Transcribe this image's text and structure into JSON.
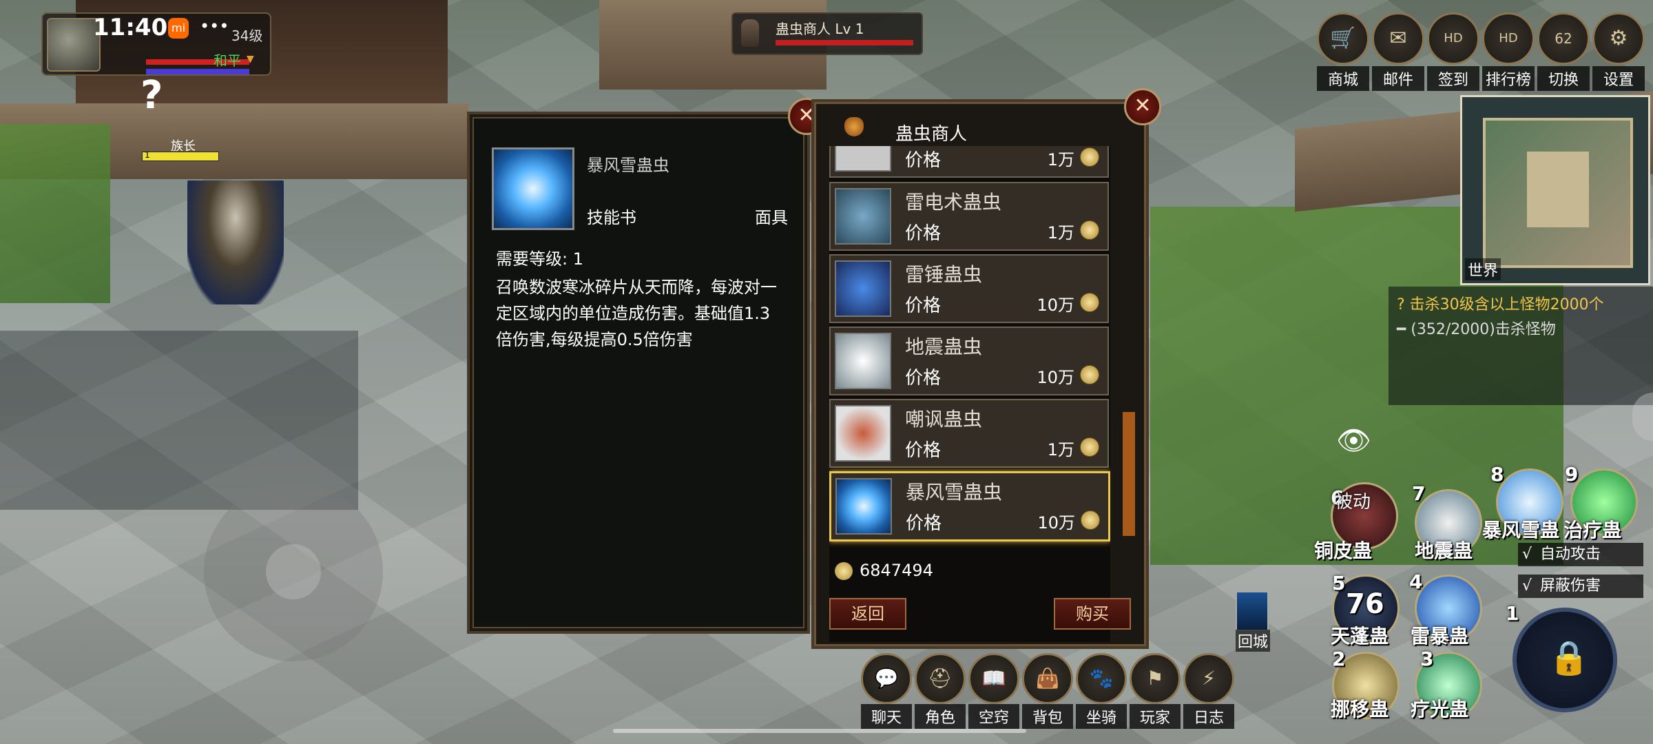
{
  "status": {
    "time": "11:40",
    "app_badge": "mi",
    "menu_dots": "•••",
    "battery": "62"
  },
  "player": {
    "level": "34级",
    "mode": "和平",
    "mode_arrow": "▼"
  },
  "target": {
    "name": "蛊虫商人  Lv 1"
  },
  "npc": {
    "marker": "?",
    "title": "族长",
    "hp_level": "1"
  },
  "top_menu": [
    {
      "label": "商城",
      "icon": "cart-icon",
      "glyph": "🛒"
    },
    {
      "label": "邮件",
      "icon": "mail-icon",
      "glyph": "✉"
    },
    {
      "label": "签到",
      "icon": "signal-icon",
      "glyph": "HD"
    },
    {
      "label": "排行榜",
      "icon": "rank-icon",
      "glyph": "HD"
    },
    {
      "label": "切换",
      "icon": "battery-icon",
      "glyph": "62"
    },
    {
      "label": "设置",
      "icon": "gear-icon",
      "glyph": "⚙"
    }
  ],
  "minimap": {
    "label": "世界"
  },
  "quest": {
    "title": "?  击杀30级含以上怪物2000个",
    "progress": "━ (352/2000)击杀怪物"
  },
  "detail": {
    "name": "暴风雪蛊虫",
    "type": "技能书",
    "slot": "面具",
    "requirement": "需要等级: 1",
    "description": "召唤数波寒冰碎片从天而降，每波对一定区域内的单位造成伤害。基础值1.3倍伤害,每级提高0.5倍伤害"
  },
  "shop": {
    "title": "蛊虫商人",
    "items": [
      {
        "name": "",
        "price_label": "价格",
        "price": "1万",
        "color": "#555"
      },
      {
        "name": "雷电术蛊虫",
        "price_label": "价格",
        "price": "1万",
        "color": "#3b6a8a"
      },
      {
        "name": "雷锤蛊虫",
        "price_label": "价格",
        "price": "10万",
        "color": "#2a4a8a"
      },
      {
        "name": "地震蛊虫",
        "price_label": "价格",
        "price": "10万",
        "color": "#9aa0a0"
      },
      {
        "name": "嘲讽蛊虫",
        "price_label": "价格",
        "price": "1万",
        "color": "#8a3a2a"
      },
      {
        "name": "暴风雪蛊虫",
        "price_label": "价格",
        "price": "10万",
        "color": "#3a8ad8"
      }
    ],
    "money": "6847494",
    "back_label": "返回",
    "buy_label": "购买"
  },
  "bottom_menu": [
    {
      "label": "聊天",
      "glyph": "💬"
    },
    {
      "label": "角色",
      "glyph": "⛑"
    },
    {
      "label": "空窍",
      "glyph": "📖"
    },
    {
      "label": "背包",
      "glyph": "👜"
    },
    {
      "label": "坐骑",
      "glyph": "🐾"
    },
    {
      "label": "玩家",
      "glyph": "⚑"
    },
    {
      "label": "日志",
      "glyph": "⚡"
    }
  ],
  "return_town": "回城",
  "skills": [
    {
      "num": "6",
      "name": "铜皮蛊",
      "top": "被动"
    },
    {
      "num": "7",
      "name": "地震蛊"
    },
    {
      "num": "8",
      "name": "暴风雪蛊"
    },
    {
      "num": "9",
      "name": "治疗蛊"
    },
    {
      "num": "5",
      "name": "天蓬蛊",
      "cooldown": "76"
    },
    {
      "num": "4",
      "name": "雷暴蛊"
    },
    {
      "num": "2",
      "name": "挪移蛊"
    },
    {
      "num": "3",
      "name": "疗光蛊"
    },
    {
      "num": "1"
    }
  ],
  "toggles": {
    "auto_attack": "自动攻击",
    "block_damage": "屏蔽伤害",
    "check": "√"
  }
}
